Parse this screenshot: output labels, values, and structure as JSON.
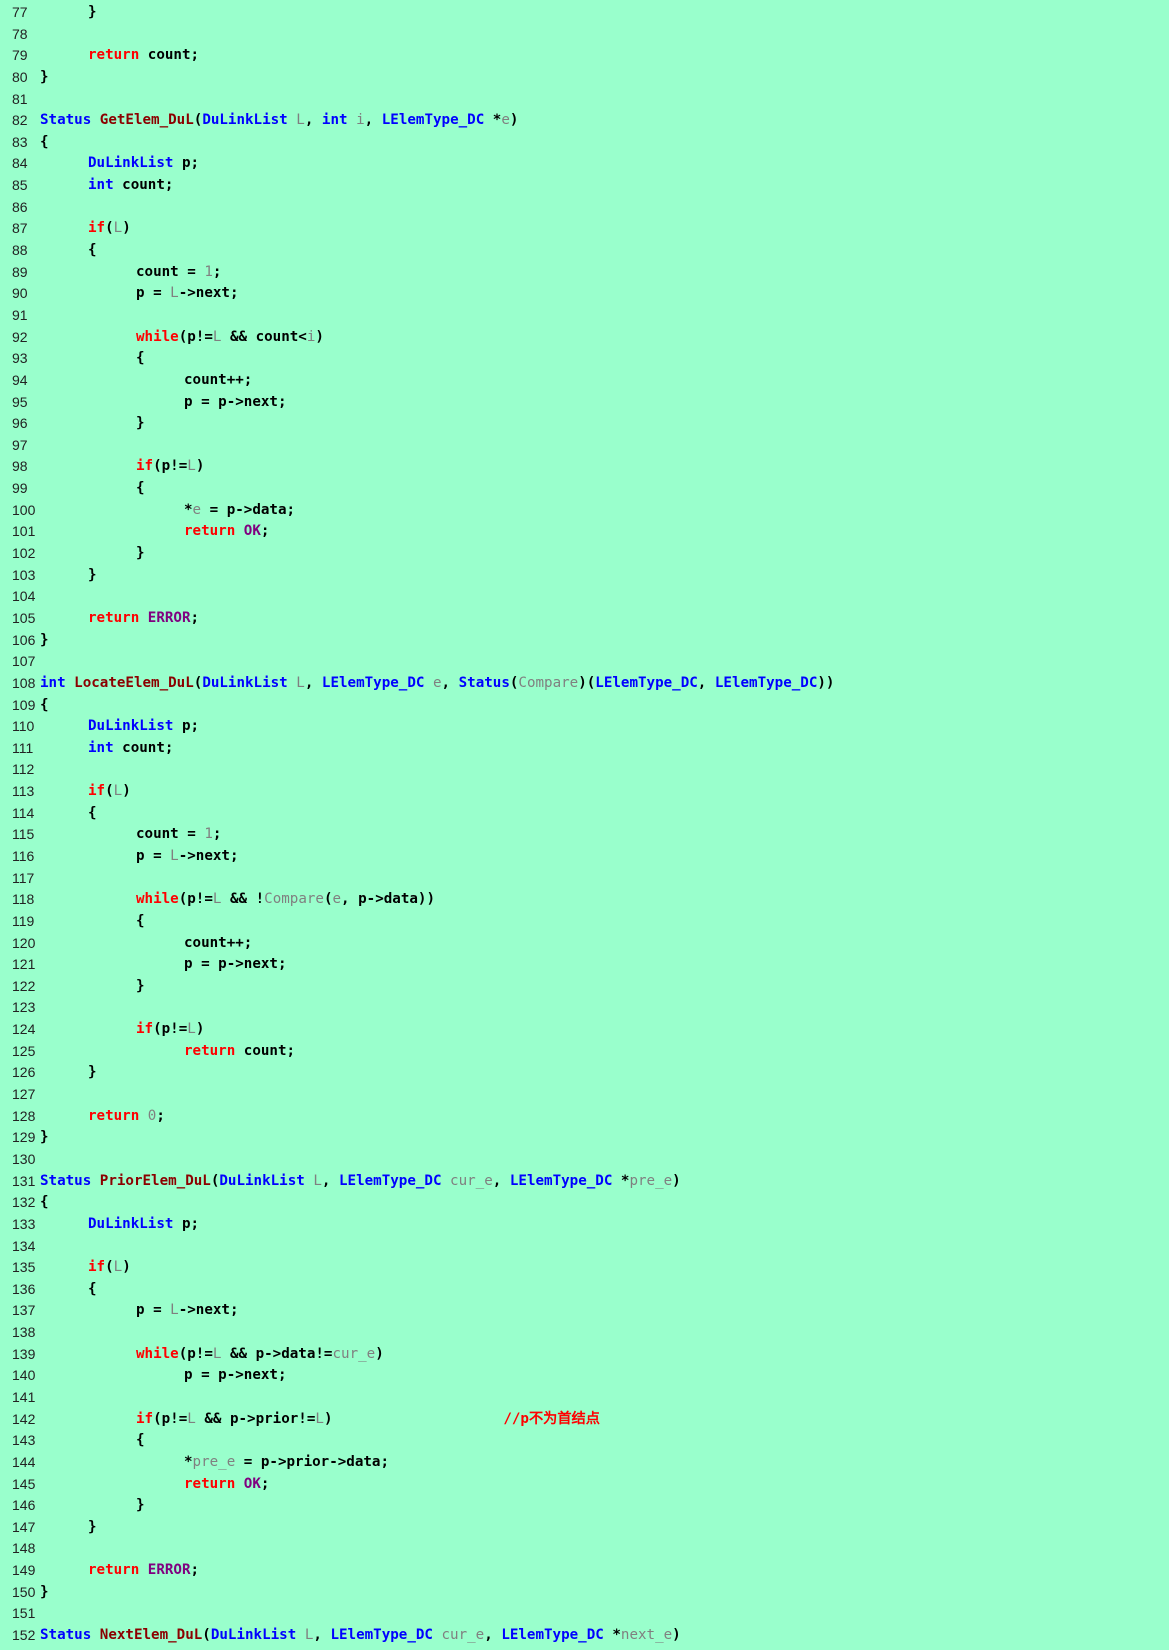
{
  "colors": {
    "background": "#99ffcc",
    "plain": "#000000",
    "keyword": "#ff0000",
    "type": "#0000ff",
    "param": "#808080",
    "func": "#8b0000",
    "macro": "#800080",
    "comment": "#ff0000",
    "line_number": "#222222"
  },
  "lines": [
    {
      "n": "77",
      "indent": 1,
      "tokens": [
        {
          "t": "}",
          "c": "plain"
        }
      ]
    },
    {
      "n": "78",
      "indent": 0,
      "tokens": []
    },
    {
      "n": "79",
      "indent": 1,
      "tokens": [
        {
          "t": "return",
          "c": "keyword"
        },
        {
          "t": " count;",
          "c": "plain"
        }
      ]
    },
    {
      "n": "80",
      "indent": 0,
      "tokens": [
        {
          "t": "}",
          "c": "plain"
        }
      ]
    },
    {
      "n": "81",
      "indent": 0,
      "tokens": []
    },
    {
      "n": "82",
      "indent": 0,
      "tokens": [
        {
          "t": "Status",
          "c": "type"
        },
        {
          "t": " ",
          "c": "plain"
        },
        {
          "t": "GetElem_DuL",
          "c": "func"
        },
        {
          "t": "(",
          "c": "plain"
        },
        {
          "t": "DuLinkList",
          "c": "type"
        },
        {
          "t": " ",
          "c": "plain"
        },
        {
          "t": "L",
          "c": "param"
        },
        {
          "t": ", ",
          "c": "plain"
        },
        {
          "t": "int",
          "c": "type"
        },
        {
          "t": " ",
          "c": "plain"
        },
        {
          "t": "i",
          "c": "param"
        },
        {
          "t": ", ",
          "c": "plain"
        },
        {
          "t": "LElemType_DC",
          "c": "type"
        },
        {
          "t": " *",
          "c": "plain"
        },
        {
          "t": "e",
          "c": "param"
        },
        {
          "t": ")",
          "c": "plain"
        }
      ]
    },
    {
      "n": "83",
      "indent": 0,
      "tokens": [
        {
          "t": "{",
          "c": "plain"
        }
      ]
    },
    {
      "n": "84",
      "indent": 1,
      "tokens": [
        {
          "t": "DuLinkList",
          "c": "type"
        },
        {
          "t": " p;",
          "c": "plain"
        }
      ]
    },
    {
      "n": "85",
      "indent": 1,
      "tokens": [
        {
          "t": "int",
          "c": "type"
        },
        {
          "t": " count;",
          "c": "plain"
        }
      ]
    },
    {
      "n": "86",
      "indent": 0,
      "tokens": []
    },
    {
      "n": "87",
      "indent": 1,
      "tokens": [
        {
          "t": "if",
          "c": "keyword"
        },
        {
          "t": "(",
          "c": "plain"
        },
        {
          "t": "L",
          "c": "param"
        },
        {
          "t": ")",
          "c": "plain"
        }
      ]
    },
    {
      "n": "88",
      "indent": 1,
      "tokens": [
        {
          "t": "{",
          "c": "plain"
        }
      ]
    },
    {
      "n": "89",
      "indent": 2,
      "tokens": [
        {
          "t": "count = ",
          "c": "plain"
        },
        {
          "t": "1",
          "c": "param"
        },
        {
          "t": ";",
          "c": "plain"
        }
      ]
    },
    {
      "n": "90",
      "indent": 2,
      "tokens": [
        {
          "t": "p = ",
          "c": "plain"
        },
        {
          "t": "L",
          "c": "param"
        },
        {
          "t": "->next;",
          "c": "plain"
        }
      ]
    },
    {
      "n": "91",
      "indent": 0,
      "tokens": []
    },
    {
      "n": "92",
      "indent": 2,
      "tokens": [
        {
          "t": "while",
          "c": "keyword"
        },
        {
          "t": "(p!=",
          "c": "plain"
        },
        {
          "t": "L",
          "c": "param"
        },
        {
          "t": " && count<",
          "c": "plain"
        },
        {
          "t": "i",
          "c": "param"
        },
        {
          "t": ")",
          "c": "plain"
        }
      ]
    },
    {
      "n": "93",
      "indent": 2,
      "tokens": [
        {
          "t": "{",
          "c": "plain"
        }
      ]
    },
    {
      "n": "94",
      "indent": 3,
      "tokens": [
        {
          "t": "count++;",
          "c": "plain"
        }
      ]
    },
    {
      "n": "95",
      "indent": 3,
      "tokens": [
        {
          "t": "p = p->next;",
          "c": "plain"
        }
      ]
    },
    {
      "n": "96",
      "indent": 2,
      "tokens": [
        {
          "t": "}",
          "c": "plain"
        }
      ]
    },
    {
      "n": "97",
      "indent": 0,
      "tokens": []
    },
    {
      "n": "98",
      "indent": 2,
      "tokens": [
        {
          "t": "if",
          "c": "keyword"
        },
        {
          "t": "(p!=",
          "c": "plain"
        },
        {
          "t": "L",
          "c": "param"
        },
        {
          "t": ")",
          "c": "plain"
        }
      ]
    },
    {
      "n": "99",
      "indent": 2,
      "tokens": [
        {
          "t": "{",
          "c": "plain"
        }
      ]
    },
    {
      "n": "100",
      "indent": 3,
      "tokens": [
        {
          "t": "*",
          "c": "plain"
        },
        {
          "t": "e",
          "c": "param"
        },
        {
          "t": " = p->data;",
          "c": "plain"
        }
      ]
    },
    {
      "n": "101",
      "indent": 3,
      "tokens": [
        {
          "t": "return",
          "c": "keyword"
        },
        {
          "t": " ",
          "c": "plain"
        },
        {
          "t": "OK",
          "c": "macro"
        },
        {
          "t": ";",
          "c": "plain"
        }
      ]
    },
    {
      "n": "102",
      "indent": 2,
      "tokens": [
        {
          "t": "}",
          "c": "plain"
        }
      ]
    },
    {
      "n": "103",
      "indent": 1,
      "tokens": [
        {
          "t": "}",
          "c": "plain"
        }
      ]
    },
    {
      "n": "104",
      "indent": 0,
      "tokens": []
    },
    {
      "n": "105",
      "indent": 1,
      "tokens": [
        {
          "t": "return",
          "c": "keyword"
        },
        {
          "t": " ",
          "c": "plain"
        },
        {
          "t": "ERROR",
          "c": "macro"
        },
        {
          "t": ";",
          "c": "plain"
        }
      ]
    },
    {
      "n": "106",
      "indent": 0,
      "tokens": [
        {
          "t": "}",
          "c": "plain"
        }
      ]
    },
    {
      "n": "107",
      "indent": 0,
      "tokens": []
    },
    {
      "n": "108",
      "indent": 0,
      "tokens": [
        {
          "t": "int",
          "c": "type"
        },
        {
          "t": " ",
          "c": "plain"
        },
        {
          "t": "LocateElem_DuL",
          "c": "func"
        },
        {
          "t": "(",
          "c": "plain"
        },
        {
          "t": "DuLinkList",
          "c": "type"
        },
        {
          "t": " ",
          "c": "plain"
        },
        {
          "t": "L",
          "c": "param"
        },
        {
          "t": ", ",
          "c": "plain"
        },
        {
          "t": "LElemType_DC",
          "c": "type"
        },
        {
          "t": " ",
          "c": "plain"
        },
        {
          "t": "e",
          "c": "param"
        },
        {
          "t": ", ",
          "c": "plain"
        },
        {
          "t": "Status",
          "c": "type"
        },
        {
          "t": "(",
          "c": "plain"
        },
        {
          "t": "Compare",
          "c": "param"
        },
        {
          "t": ")(",
          "c": "plain"
        },
        {
          "t": "LElemType_DC",
          "c": "type"
        },
        {
          "t": ", ",
          "c": "plain"
        },
        {
          "t": "LElemType_DC",
          "c": "type"
        },
        {
          "t": "))",
          "c": "plain"
        }
      ]
    },
    {
      "n": "109",
      "indent": 0,
      "tokens": [
        {
          "t": "{",
          "c": "plain"
        }
      ]
    },
    {
      "n": "110",
      "indent": 1,
      "tokens": [
        {
          "t": "DuLinkList",
          "c": "type"
        },
        {
          "t": " p;",
          "c": "plain"
        }
      ]
    },
    {
      "n": "111",
      "indent": 1,
      "tokens": [
        {
          "t": "int",
          "c": "type"
        },
        {
          "t": " count;",
          "c": "plain"
        }
      ]
    },
    {
      "n": "112",
      "indent": 0,
      "tokens": []
    },
    {
      "n": "113",
      "indent": 1,
      "tokens": [
        {
          "t": "if",
          "c": "keyword"
        },
        {
          "t": "(",
          "c": "plain"
        },
        {
          "t": "L",
          "c": "param"
        },
        {
          "t": ")",
          "c": "plain"
        }
      ]
    },
    {
      "n": "114",
      "indent": 1,
      "tokens": [
        {
          "t": "{",
          "c": "plain"
        }
      ]
    },
    {
      "n": "115",
      "indent": 2,
      "tokens": [
        {
          "t": "count = ",
          "c": "plain"
        },
        {
          "t": "1",
          "c": "param"
        },
        {
          "t": ";",
          "c": "plain"
        }
      ]
    },
    {
      "n": "116",
      "indent": 2,
      "tokens": [
        {
          "t": "p = ",
          "c": "plain"
        },
        {
          "t": "L",
          "c": "param"
        },
        {
          "t": "->next;",
          "c": "plain"
        }
      ]
    },
    {
      "n": "117",
      "indent": 0,
      "tokens": []
    },
    {
      "n": "118",
      "indent": 2,
      "tokens": [
        {
          "t": "while",
          "c": "keyword"
        },
        {
          "t": "(p!=",
          "c": "plain"
        },
        {
          "t": "L",
          "c": "param"
        },
        {
          "t": " && !",
          "c": "plain"
        },
        {
          "t": "Compare",
          "c": "param"
        },
        {
          "t": "(",
          "c": "plain"
        },
        {
          "t": "e",
          "c": "param"
        },
        {
          "t": ", p->data))",
          "c": "plain"
        }
      ]
    },
    {
      "n": "119",
      "indent": 2,
      "tokens": [
        {
          "t": "{",
          "c": "plain"
        }
      ]
    },
    {
      "n": "120",
      "indent": 3,
      "tokens": [
        {
          "t": "count++;",
          "c": "plain"
        }
      ]
    },
    {
      "n": "121",
      "indent": 3,
      "tokens": [
        {
          "t": "p = p->next;",
          "c": "plain"
        }
      ]
    },
    {
      "n": "122",
      "indent": 2,
      "tokens": [
        {
          "t": "}",
          "c": "plain"
        }
      ]
    },
    {
      "n": "123",
      "indent": 0,
      "tokens": []
    },
    {
      "n": "124",
      "indent": 2,
      "tokens": [
        {
          "t": "if",
          "c": "keyword"
        },
        {
          "t": "(p!=",
          "c": "plain"
        },
        {
          "t": "L",
          "c": "param"
        },
        {
          "t": ")",
          "c": "plain"
        }
      ]
    },
    {
      "n": "125",
      "indent": 3,
      "tokens": [
        {
          "t": "return",
          "c": "keyword"
        },
        {
          "t": " count;",
          "c": "plain"
        }
      ]
    },
    {
      "n": "126",
      "indent": 1,
      "tokens": [
        {
          "t": "}",
          "c": "plain"
        }
      ]
    },
    {
      "n": "127",
      "indent": 0,
      "tokens": []
    },
    {
      "n": "128",
      "indent": 1,
      "tokens": [
        {
          "t": "return",
          "c": "keyword"
        },
        {
          "t": " ",
          "c": "plain"
        },
        {
          "t": "0",
          "c": "param"
        },
        {
          "t": ";",
          "c": "plain"
        }
      ]
    },
    {
      "n": "129",
      "indent": 0,
      "tokens": [
        {
          "t": "}",
          "c": "plain"
        }
      ]
    },
    {
      "n": "130",
      "indent": 0,
      "tokens": []
    },
    {
      "n": "131",
      "indent": 0,
      "tokens": [
        {
          "t": "Status",
          "c": "type"
        },
        {
          "t": " ",
          "c": "plain"
        },
        {
          "t": "PriorElem_DuL",
          "c": "func"
        },
        {
          "t": "(",
          "c": "plain"
        },
        {
          "t": "DuLinkList",
          "c": "type"
        },
        {
          "t": " ",
          "c": "plain"
        },
        {
          "t": "L",
          "c": "param"
        },
        {
          "t": ", ",
          "c": "plain"
        },
        {
          "t": "LElemType_DC",
          "c": "type"
        },
        {
          "t": " ",
          "c": "plain"
        },
        {
          "t": "cur_e",
          "c": "param"
        },
        {
          "t": ", ",
          "c": "plain"
        },
        {
          "t": "LElemType_DC",
          "c": "type"
        },
        {
          "t": " *",
          "c": "plain"
        },
        {
          "t": "pre_e",
          "c": "param"
        },
        {
          "t": ")",
          "c": "plain"
        }
      ]
    },
    {
      "n": "132",
      "indent": 0,
      "tokens": [
        {
          "t": "{",
          "c": "plain"
        }
      ]
    },
    {
      "n": "133",
      "indent": 1,
      "tokens": [
        {
          "t": "DuLinkList",
          "c": "type"
        },
        {
          "t": " p;",
          "c": "plain"
        }
      ]
    },
    {
      "n": "134",
      "indent": 0,
      "tokens": []
    },
    {
      "n": "135",
      "indent": 1,
      "tokens": [
        {
          "t": "if",
          "c": "keyword"
        },
        {
          "t": "(",
          "c": "plain"
        },
        {
          "t": "L",
          "c": "param"
        },
        {
          "t": ")",
          "c": "plain"
        }
      ]
    },
    {
      "n": "136",
      "indent": 1,
      "tokens": [
        {
          "t": "{",
          "c": "plain"
        }
      ]
    },
    {
      "n": "137",
      "indent": 2,
      "tokens": [
        {
          "t": "p = ",
          "c": "plain"
        },
        {
          "t": "L",
          "c": "param"
        },
        {
          "t": "->next;",
          "c": "plain"
        }
      ]
    },
    {
      "n": "138",
      "indent": 0,
      "tokens": []
    },
    {
      "n": "139",
      "indent": 2,
      "tokens": [
        {
          "t": "while",
          "c": "keyword"
        },
        {
          "t": "(p!=",
          "c": "plain"
        },
        {
          "t": "L",
          "c": "param"
        },
        {
          "t": " && p->data!=",
          "c": "plain"
        },
        {
          "t": "cur_e",
          "c": "param"
        },
        {
          "t": ")",
          "c": "plain"
        }
      ]
    },
    {
      "n": "140",
      "indent": 3,
      "tokens": [
        {
          "t": "p = p->next;",
          "c": "plain"
        }
      ]
    },
    {
      "n": "141",
      "indent": 0,
      "tokens": []
    },
    {
      "n": "142",
      "indent": 2,
      "tokens": [
        {
          "t": "if",
          "c": "keyword"
        },
        {
          "t": "(p!=",
          "c": "plain"
        },
        {
          "t": "L",
          "c": "param"
        },
        {
          "t": " && p->prior!=",
          "c": "plain"
        },
        {
          "t": "L",
          "c": "param"
        },
        {
          "t": ")                    ",
          "c": "plain"
        },
        {
          "t": "//p不为首结点",
          "c": "comment"
        }
      ]
    },
    {
      "n": "143",
      "indent": 2,
      "tokens": [
        {
          "t": "{",
          "c": "plain"
        }
      ]
    },
    {
      "n": "144",
      "indent": 3,
      "tokens": [
        {
          "t": "*",
          "c": "plain"
        },
        {
          "t": "pre_e",
          "c": "param"
        },
        {
          "t": " = p->prior->data;",
          "c": "plain"
        }
      ]
    },
    {
      "n": "145",
      "indent": 3,
      "tokens": [
        {
          "t": "return",
          "c": "keyword"
        },
        {
          "t": " ",
          "c": "plain"
        },
        {
          "t": "OK",
          "c": "macro"
        },
        {
          "t": ";",
          "c": "plain"
        }
      ]
    },
    {
      "n": "146",
      "indent": 2,
      "tokens": [
        {
          "t": "}",
          "c": "plain"
        }
      ]
    },
    {
      "n": "147",
      "indent": 1,
      "tokens": [
        {
          "t": "}",
          "c": "plain"
        }
      ]
    },
    {
      "n": "148",
      "indent": 0,
      "tokens": []
    },
    {
      "n": "149",
      "indent": 1,
      "tokens": [
        {
          "t": "return",
          "c": "keyword"
        },
        {
          "t": " ",
          "c": "plain"
        },
        {
          "t": "ERROR",
          "c": "macro"
        },
        {
          "t": ";",
          "c": "plain"
        }
      ]
    },
    {
      "n": "150",
      "indent": 0,
      "tokens": [
        {
          "t": "}",
          "c": "plain"
        }
      ]
    },
    {
      "n": "151",
      "indent": 0,
      "tokens": []
    },
    {
      "n": "152",
      "indent": 0,
      "tokens": [
        {
          "t": "Status",
          "c": "type"
        },
        {
          "t": " ",
          "c": "plain"
        },
        {
          "t": "NextElem_DuL",
          "c": "func"
        },
        {
          "t": "(",
          "c": "plain"
        },
        {
          "t": "DuLinkList",
          "c": "type"
        },
        {
          "t": " ",
          "c": "plain"
        },
        {
          "t": "L",
          "c": "param"
        },
        {
          "t": ", ",
          "c": "plain"
        },
        {
          "t": "LElemType_DC",
          "c": "type"
        },
        {
          "t": " ",
          "c": "plain"
        },
        {
          "t": "cur_e",
          "c": "param"
        },
        {
          "t": ", ",
          "c": "plain"
        },
        {
          "t": "LElemType_DC",
          "c": "type"
        },
        {
          "t": " *",
          "c": "plain"
        },
        {
          "t": "next_e",
          "c": "param"
        },
        {
          "t": ")",
          "c": "plain"
        }
      ]
    }
  ]
}
